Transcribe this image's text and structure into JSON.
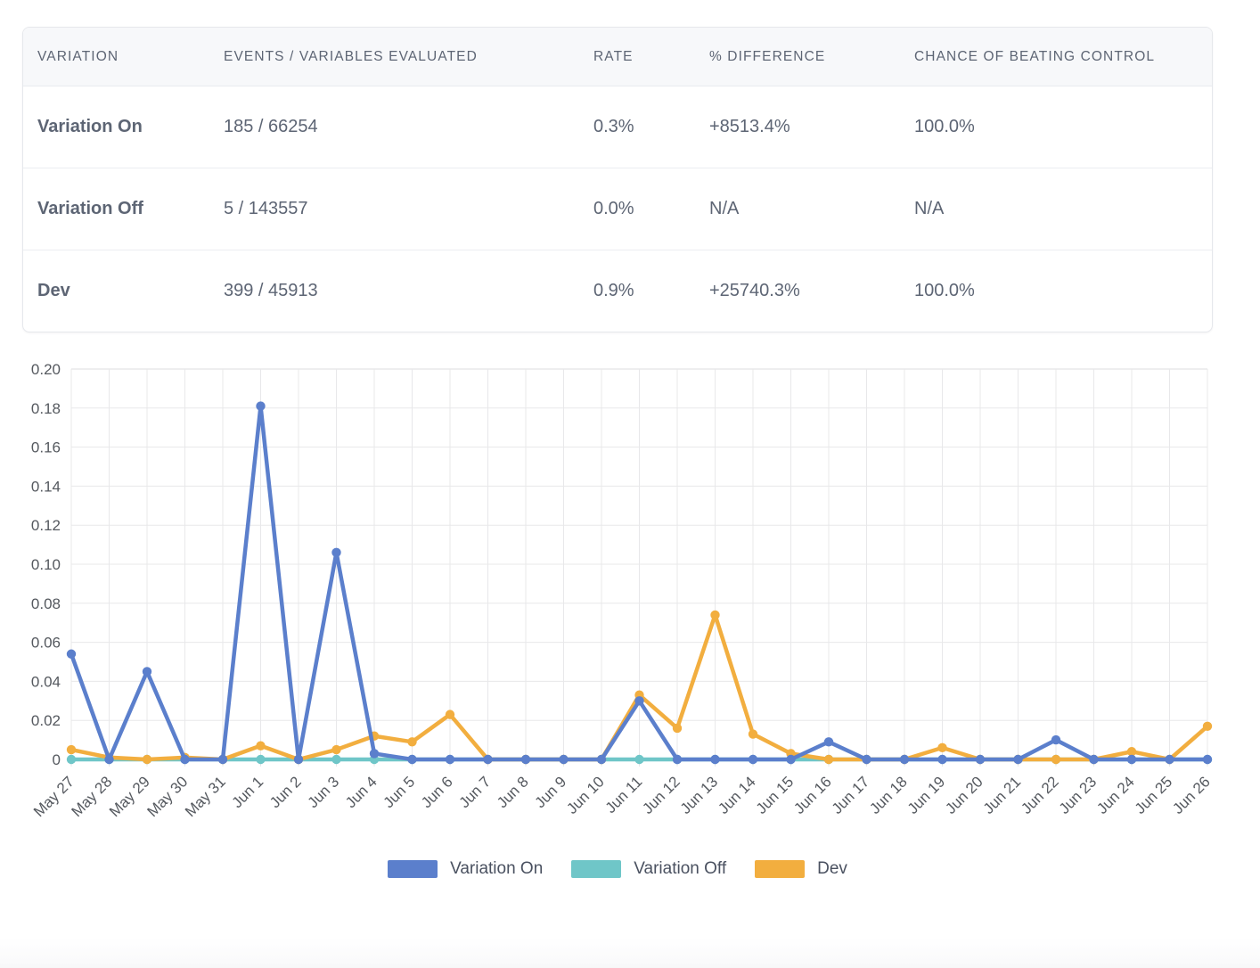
{
  "table": {
    "columns": [
      "VARIATION",
      "EVENTS / VARIABLES EVALUATED",
      "RATE",
      "% DIFFERENCE",
      "CHANCE OF BEATING CONTROL"
    ],
    "rows": [
      {
        "variation": "Variation On",
        "events": "185 / 66254",
        "rate": "0.3%",
        "difference": "+8513.4%",
        "difference_positive": true,
        "chance": "100.0%",
        "chance_positive": true
      },
      {
        "variation": "Variation Off",
        "events": "5 / 143557",
        "rate": "0.0%",
        "difference": "N/A",
        "difference_positive": false,
        "chance": "N/A",
        "chance_positive": false
      },
      {
        "variation": "Dev",
        "events": "399 / 45913",
        "rate": "0.9%",
        "difference": "+25740.3%",
        "difference_positive": true,
        "chance": "100.0%",
        "chance_positive": true
      }
    ]
  },
  "colors": {
    "variation_on": "#5b7fcc",
    "variation_off": "#6fc6c8",
    "dev": "#f2ae3f",
    "positive": "#3dbb9a",
    "grid": "#e8e8ea",
    "axis_text": "#55595f"
  },
  "chart_data": {
    "type": "line",
    "title": "",
    "xlabel": "",
    "ylabel": "",
    "ylim": [
      0,
      0.2
    ],
    "ytick_step": 0.02,
    "ytick_labels": [
      "0",
      "0.02",
      "0.04",
      "0.06",
      "0.08",
      "0.10",
      "0.12",
      "0.14",
      "0.16",
      "0.18",
      "0.20"
    ],
    "grid": true,
    "legend_position": "bottom",
    "categories": [
      "May 27",
      "May 28",
      "May 29",
      "May 30",
      "May 31",
      "Jun 1",
      "Jun 2",
      "Jun 3",
      "Jun 4",
      "Jun 5",
      "Jun 6",
      "Jun 7",
      "Jun 8",
      "Jun 9",
      "Jun 10",
      "Jun 11",
      "Jun 12",
      "Jun 13",
      "Jun 14",
      "Jun 15",
      "Jun 16",
      "Jun 17",
      "Jun 18",
      "Jun 19",
      "Jun 20",
      "Jun 21",
      "Jun 22",
      "Jun 23",
      "Jun 24",
      "Jun 25",
      "Jun 26"
    ],
    "series": [
      {
        "name": "Variation On",
        "color": "#5b7fcc",
        "values": [
          0.054,
          0.0,
          0.045,
          0.0,
          0.0,
          0.181,
          0.0,
          0.106,
          0.003,
          0.0,
          0.0,
          0.0,
          0.0,
          0.0,
          0.0,
          0.03,
          0.0,
          0.0,
          0.0,
          0.0,
          0.009,
          0.0,
          0.0,
          0.0,
          0.0,
          0.0,
          0.01,
          0.0,
          0.0,
          0.0,
          0.0
        ]
      },
      {
        "name": "Variation Off",
        "color": "#6fc6c8",
        "values": [
          0.0,
          0.0,
          0.0,
          0.0,
          0.0,
          0.0,
          0.0,
          0.0,
          0.0,
          0.0,
          0.0,
          0.0,
          0.0,
          0.0,
          0.0,
          0.0,
          0.0,
          0.0,
          0.0,
          0.0,
          0.0,
          0.0,
          0.0,
          0.0,
          0.0,
          0.0,
          0.0,
          0.0,
          0.0,
          0.0,
          0.0
        ]
      },
      {
        "name": "Dev",
        "color": "#f2ae3f",
        "values": [
          0.005,
          0.001,
          0.0,
          0.001,
          0.0,
          0.007,
          0.0,
          0.005,
          0.012,
          0.009,
          0.023,
          0.0,
          0.0,
          0.0,
          0.0,
          0.033,
          0.016,
          0.074,
          0.013,
          0.003,
          0.0,
          0.0,
          0.0,
          0.006,
          0.0,
          0.0,
          0.0,
          0.0,
          0.004,
          0.0,
          0.017
        ]
      }
    ]
  },
  "legend": {
    "items": [
      {
        "label": "Variation On",
        "color": "#5b7fcc"
      },
      {
        "label": "Variation Off",
        "color": "#6fc6c8"
      },
      {
        "label": "Dev",
        "color": "#f2ae3f"
      }
    ]
  }
}
